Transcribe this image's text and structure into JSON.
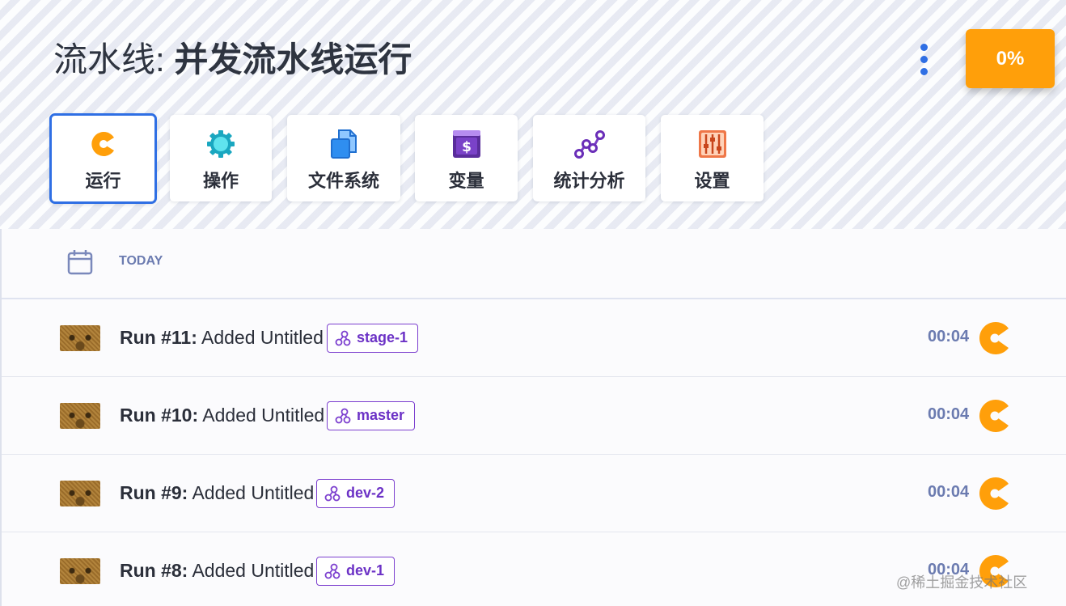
{
  "header": {
    "title_prefix": "流水线:",
    "title_name": "并发流水线运行",
    "progress_label": "0%"
  },
  "tabs": [
    {
      "label": "运行",
      "icon": "pacman-spinner-icon",
      "active": true
    },
    {
      "label": "操作",
      "icon": "gear-icon",
      "active": false
    },
    {
      "label": "文件系统",
      "icon": "files-icon",
      "active": false
    },
    {
      "label": "变量",
      "icon": "dollar-icon",
      "active": false
    },
    {
      "label": "统计分析",
      "icon": "graph-icon",
      "active": false
    },
    {
      "label": "设置",
      "icon": "sliders-icon",
      "active": false
    }
  ],
  "section": {
    "label": "TODAY",
    "icon": "calendar-icon"
  },
  "runs": [
    {
      "number": "Run #11:",
      "message": "Added Untitled",
      "branch": "stage-1",
      "duration": "00:04",
      "status_icon": "running-spinner-icon"
    },
    {
      "number": "Run #10:",
      "message": "Added Untitled",
      "branch": "master",
      "duration": "00:04",
      "status_icon": "running-spinner-icon"
    },
    {
      "number": "Run #9:",
      "message": "Added Untitled",
      "branch": "dev-2",
      "duration": "00:04",
      "status_icon": "running-spinner-icon"
    },
    {
      "number": "Run #8:",
      "message": "Added Untitled",
      "branch": "dev-1",
      "duration": "00:04",
      "status_icon": "running-spinner-icon"
    }
  ],
  "colors": {
    "accent_blue": "#2f6fe4",
    "orange": "#ff9f0a",
    "branch_purple": "#7c3fcf",
    "muted_blue": "#6b7bb0"
  },
  "watermark": "@稀土掘金技术社区"
}
